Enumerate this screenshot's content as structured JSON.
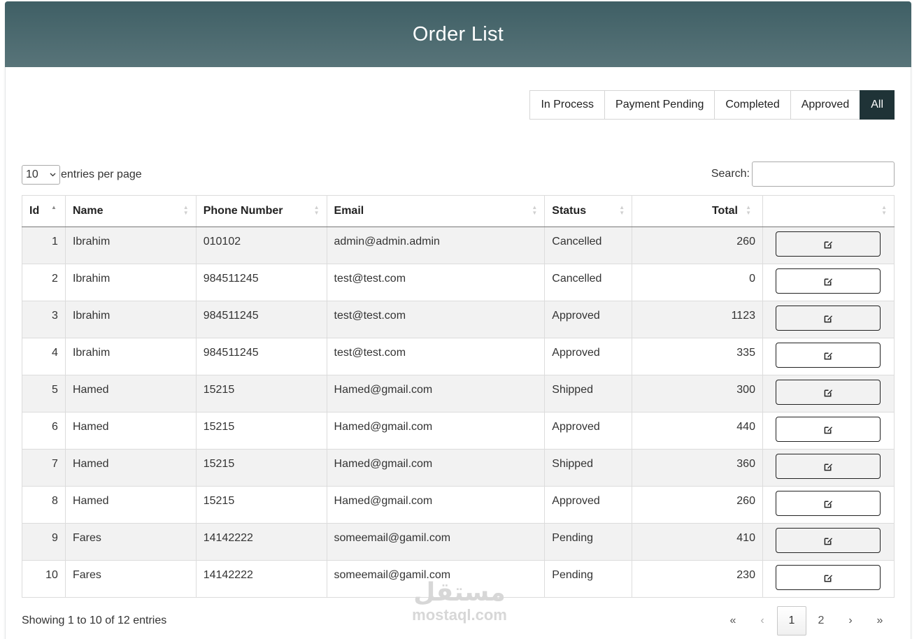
{
  "page": {
    "title": "Order List"
  },
  "filters": [
    {
      "label": "In Process",
      "active": false
    },
    {
      "label": "Payment Pending",
      "active": false
    },
    {
      "label": "Completed",
      "active": false
    },
    {
      "label": "Approved",
      "active": false
    },
    {
      "label": "All",
      "active": true
    }
  ],
  "length": {
    "value": "10",
    "label": "entries per page"
  },
  "search": {
    "label": "Search:",
    "value": ""
  },
  "table": {
    "columns": [
      "Id",
      "Name",
      "Phone Number",
      "Email",
      "Status",
      "Total",
      ""
    ],
    "rows": [
      {
        "id": "1",
        "name": "Ibrahim",
        "phone": "010102",
        "email": "admin@admin.admin",
        "status": "Cancelled",
        "total": "260"
      },
      {
        "id": "2",
        "name": "Ibrahim",
        "phone": "984511245",
        "email": "test@test.com",
        "status": "Cancelled",
        "total": "0"
      },
      {
        "id": "3",
        "name": "Ibrahim",
        "phone": "984511245",
        "email": "test@test.com",
        "status": "Approved",
        "total": "1123"
      },
      {
        "id": "4",
        "name": "Ibrahim",
        "phone": "984511245",
        "email": "test@test.com",
        "status": "Approved",
        "total": "335"
      },
      {
        "id": "5",
        "name": "Hamed",
        "phone": "15215",
        "email": "Hamed@gmail.com",
        "status": "Shipped",
        "total": "300"
      },
      {
        "id": "6",
        "name": "Hamed",
        "phone": "15215",
        "email": "Hamed@gmail.com",
        "status": "Approved",
        "total": "440"
      },
      {
        "id": "7",
        "name": "Hamed",
        "phone": "15215",
        "email": "Hamed@gmail.com",
        "status": "Shipped",
        "total": "360"
      },
      {
        "id": "8",
        "name": "Hamed",
        "phone": "15215",
        "email": "Hamed@gmail.com",
        "status": "Approved",
        "total": "260"
      },
      {
        "id": "9",
        "name": "Fares",
        "phone": "14142222",
        "email": "someemail@gamil.com",
        "status": "Pending",
        "total": "410"
      },
      {
        "id": "10",
        "name": "Fares",
        "phone": "14142222",
        "email": "someemail@gamil.com",
        "status": "Pending",
        "total": "230"
      }
    ],
    "row_action_icon": "edit-icon"
  },
  "info": "Showing 1 to 10 of 12 entries",
  "pagination": {
    "first": "«",
    "prev": "‹",
    "pages": [
      "1",
      "2"
    ],
    "current": "1",
    "next": "›",
    "last": "»"
  },
  "watermark": {
    "arabic": "مستقل",
    "latin": "mostaql.com"
  },
  "colors": {
    "header_top": "#3f5f65",
    "header_bottom": "#587479",
    "active_filter": "#1f3337",
    "stripe": "#f2f2f2"
  }
}
